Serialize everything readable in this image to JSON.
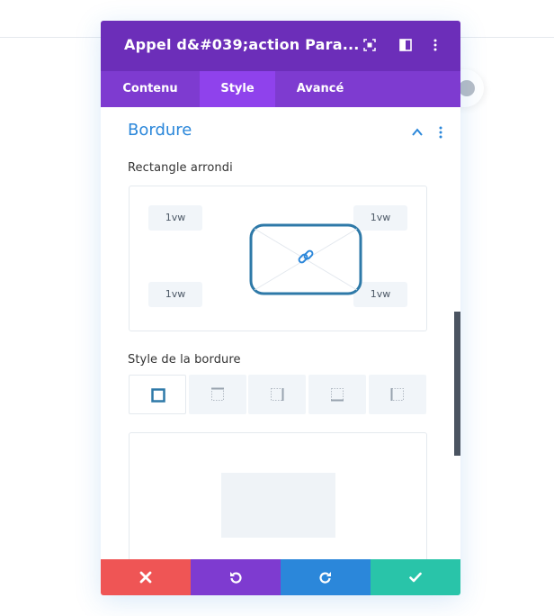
{
  "modal": {
    "title": "Appel d&#039;action Para...",
    "tabs": [
      {
        "label": "Contenu",
        "active": false
      },
      {
        "label": "Style",
        "active": true
      },
      {
        "label": "Avancé",
        "active": false
      }
    ]
  },
  "section": {
    "title": "Bordure",
    "rounded_label": "Rectangle arrondi",
    "corners": {
      "top_left": "1vw",
      "top_right": "1vw",
      "bottom_left": "1vw",
      "bottom_right": "1vw"
    },
    "border_style_label": "Style de la bordure",
    "border_styles": [
      "all",
      "top",
      "right",
      "bottom",
      "left"
    ]
  },
  "colors": {
    "header": "#6c2eb9",
    "tabs": "#7e3bd0",
    "active_tab": "#8f42ec",
    "accent": "#2b87da",
    "cancel": "#ef5555",
    "undo": "#7e3bd0",
    "redo": "#2b87da",
    "save": "#29c4a9"
  },
  "footer": {
    "icons": [
      "close-icon",
      "undo-icon",
      "redo-icon",
      "check-icon"
    ]
  }
}
